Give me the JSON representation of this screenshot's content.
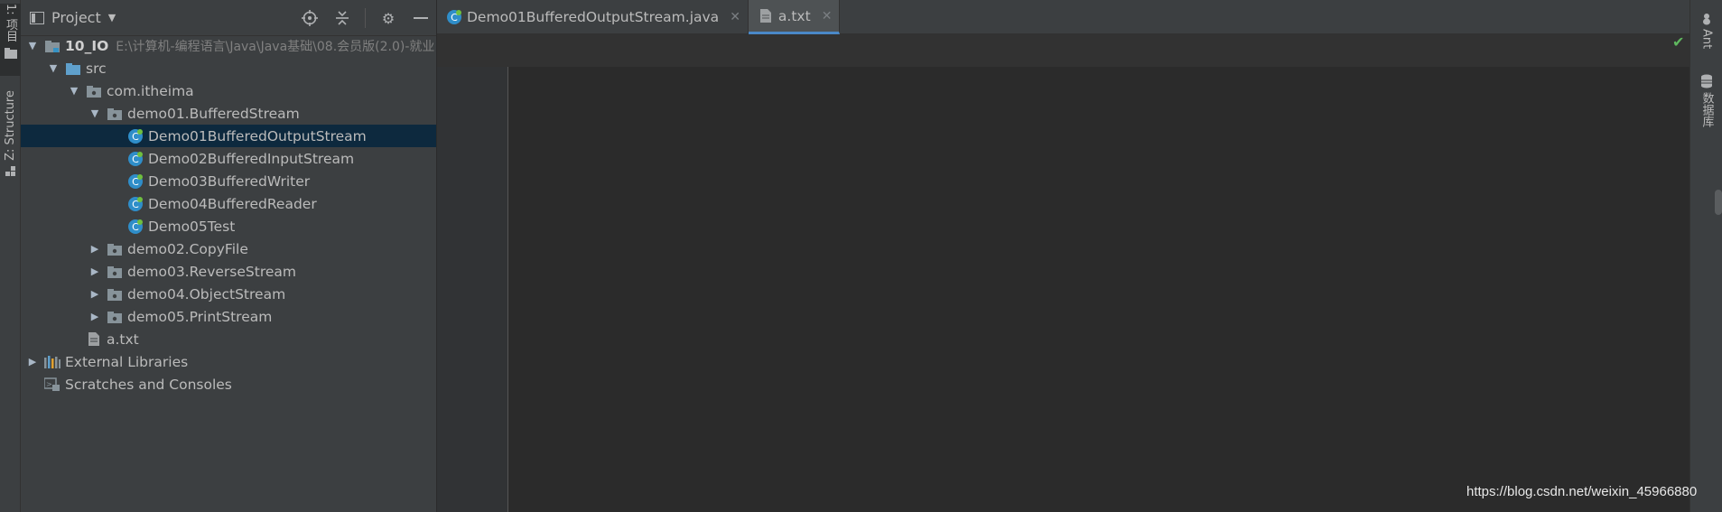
{
  "left_strip": {
    "project_tab": "1: 项目",
    "structure_tab": "Z: Structure"
  },
  "project_panel": {
    "title": "Project",
    "actions": [
      "locate-icon",
      "collapse-icon",
      "gear-icon",
      "minimize-icon"
    ]
  },
  "tree": {
    "root": {
      "name": "10_IO",
      "path": "E:\\计算机-编程语言\\Java\\Java基础\\08.会员版(2.0)-就业"
    },
    "src": "src",
    "package": "com.itheima",
    "demo01": "demo01.BufferedStream",
    "classes": [
      "Demo01BufferedOutputStream",
      "Demo02BufferedInputStream",
      "Demo03BufferedWriter",
      "Demo04BufferedReader",
      "Demo05Test"
    ],
    "packages": [
      "demo02.CopyFile",
      "demo03.ReverseStream",
      "demo04.ObjectStream",
      "demo05.PrintStream"
    ],
    "file": "a.txt",
    "ext_libs": "External Libraries",
    "scratches": "Scratches and Consoles"
  },
  "editor": {
    "tabs": [
      "Demo01BufferedOutputStream.java",
      "a.txt"
    ],
    "active_tab": 1
  },
  "right_strip": {
    "ant": "Ant",
    "database": "数据库"
  },
  "watermark": "https://blog.csdn.net/weixin_45966880",
  "colors": {
    "selection": "#0d293e",
    "tab_underline": "#4a88c7",
    "class_icon": "#2f8ec9",
    "folder": "#87939a",
    "src_folder": "#5fa0cc"
  }
}
